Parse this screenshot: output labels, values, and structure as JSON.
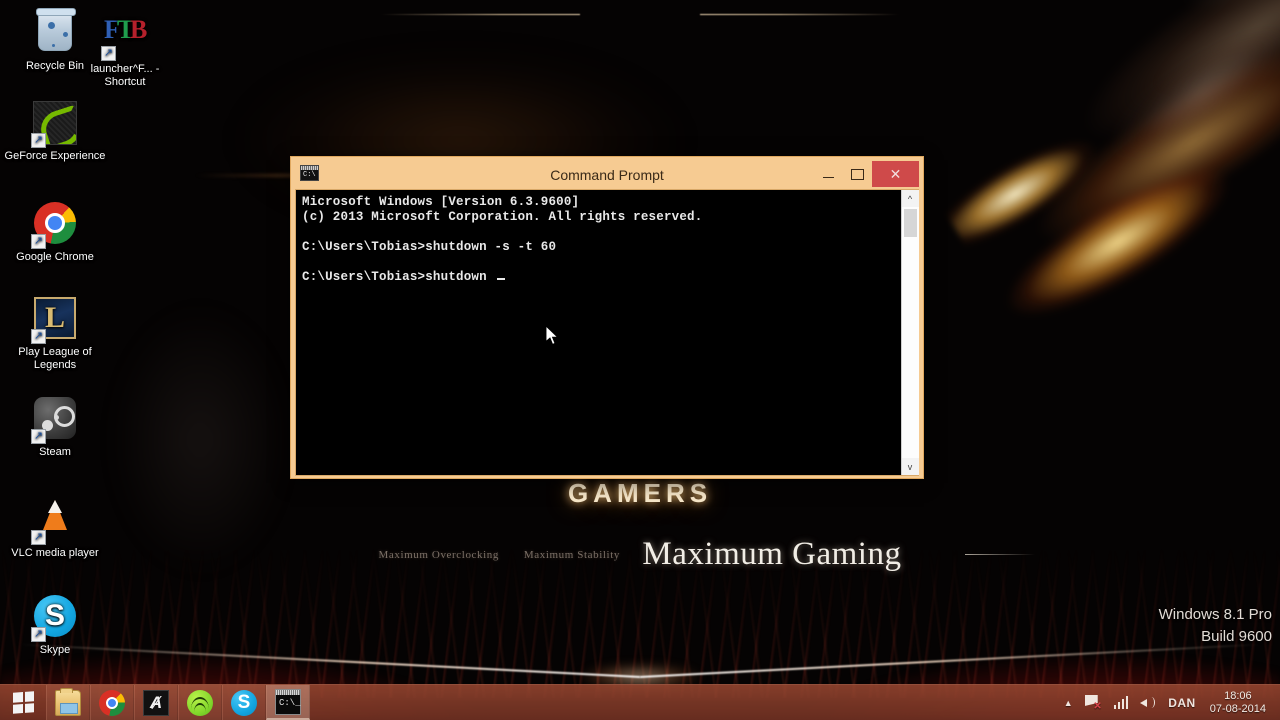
{
  "wallpaper": {
    "brand_title": "GAMERS",
    "tagline_1": "Maximum Overclocking",
    "tagline_2": "Maximum Stability",
    "tagline_3": "Maximum Gaming",
    "accent_orange": "#ff9a28",
    "accent_red": "#ff281e"
  },
  "watermark": {
    "line1": "Windows 8.1 Pro",
    "line2": "Build 9600"
  },
  "desktop_icons": [
    {
      "label": "Recycle Bin",
      "icon": "recycle-bin-icon",
      "shortcut": false
    },
    {
      "label": "launcher^F... - Shortcut",
      "icon": "ftb-launcher-icon",
      "shortcut": true
    },
    {
      "label": "GeForce Experience",
      "icon": "geforce-experience-icon",
      "shortcut": true
    },
    {
      "label": "Google Chrome",
      "icon": "chrome-icon",
      "shortcut": true
    },
    {
      "label": "Play League of Legends",
      "icon": "league-of-legends-icon",
      "shortcut": true
    },
    {
      "label": "Steam",
      "icon": "steam-icon",
      "shortcut": true
    },
    {
      "label": "VLC media player",
      "icon": "vlc-icon",
      "shortcut": true
    },
    {
      "label": "Skype",
      "icon": "skype-icon",
      "shortcut": true
    }
  ],
  "cmd_window": {
    "title": "Command Prompt",
    "icon": "command-prompt-icon",
    "titlebar_color": "#f6cb92",
    "close_button_color": "#cf4a4a",
    "minimize_label": "",
    "maximize_label": "",
    "close_label": "✕",
    "console": {
      "lines": [
        "Microsoft Windows [Version 6.3.9600]",
        "(c) 2013 Microsoft Corporation. All rights reserved.",
        "",
        "C:\\Users\\Tobias>shutdown -s -t 60",
        "",
        "C:\\Users\\Tobias>shutdown "
      ],
      "text": "Microsoft Windows [Version 6.3.9600]\n(c) 2013 Microsoft Corporation. All rights reserved.\n\nC:\\Users\\Tobias>shutdown -s -t 60\n\nC:\\Users\\Tobias>shutdown ",
      "background": "#000000",
      "foreground": "#e9e9e9"
    },
    "scrollbar": {
      "up_arrow": "^",
      "down_arrow": "v"
    }
  },
  "taskbar": {
    "start_label": "Start",
    "items": [
      {
        "name": "file-explorer",
        "label": "File Explorer",
        "active": false
      },
      {
        "name": "google-chrome",
        "label": "Google Chrome",
        "active": false
      },
      {
        "name": "ai-app",
        "label": "Ai",
        "active": false
      },
      {
        "name": "spotify",
        "label": "Spotify",
        "active": false
      },
      {
        "name": "skype",
        "label": "Skype",
        "active": false
      },
      {
        "name": "command-prompt",
        "label": "Command Prompt",
        "active": true
      }
    ],
    "tray": {
      "show_hidden": "▲",
      "network_icon": "network-flag-icon",
      "signal_icon": "signal-bars-icon",
      "volume_icon": "volume-icon",
      "user": "DAN",
      "time": "18:06",
      "date": "07-08-2014"
    }
  }
}
